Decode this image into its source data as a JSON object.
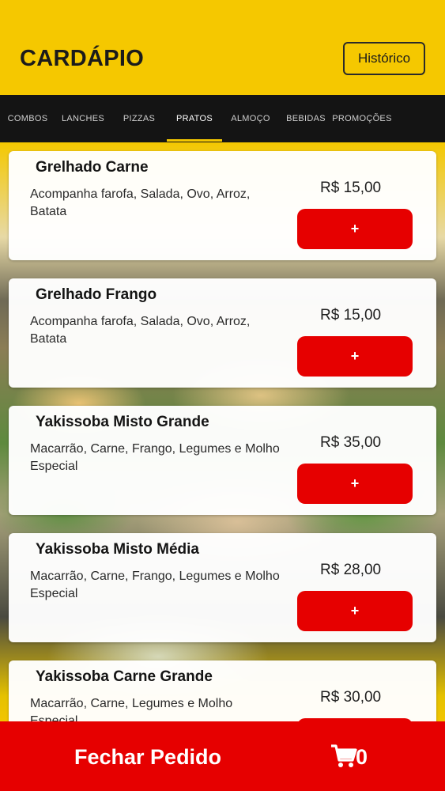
{
  "header": {
    "title": "CARDÁPIO",
    "history_label": "Histórico",
    "accent_color": "#f5c800"
  },
  "tabs": [
    {
      "label": "COMBOS"
    },
    {
      "label": "LANCHES"
    },
    {
      "label": "PIZZAS"
    },
    {
      "label": "PRATOS",
      "active": true
    },
    {
      "label": "ALMOÇO"
    },
    {
      "label": "BEBIDAS"
    },
    {
      "label": "PROMOÇÕES"
    }
  ],
  "menu_icon": "document-icon",
  "items": [
    {
      "name": "Grelhado Carne",
      "description": "Acompanha farofa, Salada, Ovo, Arroz, Batata",
      "price": "R$ 15,00",
      "add_label": "+"
    },
    {
      "name": "Grelhado Frango",
      "description": "Acompanha farofa, Salada, Ovo, Arroz, Batata",
      "price": "R$ 15,00",
      "add_label": "+"
    },
    {
      "name": "Yakissoba Misto Grande",
      "description": "Macarrão, Carne, Frango, Legumes e Molho Especial",
      "price": "R$ 35,00",
      "add_label": "+"
    },
    {
      "name": "Yakissoba Misto Média",
      "description": "Macarrão, Carne, Frango, Legumes e Molho Especial",
      "price": "R$ 28,00",
      "add_label": "+"
    },
    {
      "name": "Yakissoba Carne Grande",
      "description": "Macarrão, Carne, Legumes e Molho Especial",
      "price": "R$ 30,00",
      "add_label": "+"
    }
  ],
  "footer": {
    "close_order_label": "Fechar Pedido",
    "cart_icon": "cart-icon",
    "cart_count": "0",
    "color": "#e60000"
  }
}
